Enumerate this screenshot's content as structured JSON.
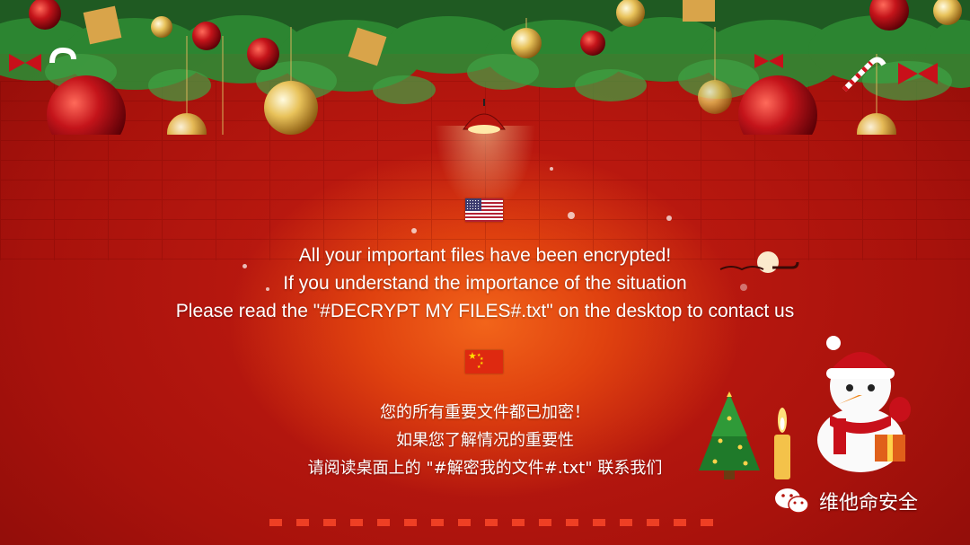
{
  "english": {
    "line1": "All your important files have been encrypted!",
    "line2": "If you understand the importance of the situation",
    "line3": "Please read the \"#DECRYPT MY FILES#.txt\" on the desktop to contact us"
  },
  "chinese": {
    "line1": "您的所有重要文件都已加密！",
    "line2": "如果您了解情况的重要性",
    "line3": "请阅读桌面上的 \"#解密我的文件#.txt\" 联系我们"
  },
  "watermark": {
    "text": "维他命安全",
    "icon": "wechat-icon"
  },
  "decor": {
    "us_flag_icon": "us-flag-icon",
    "cn_flag_icon": "china-flag-icon",
    "colors": {
      "background": "#b5140d",
      "glow": "#f2641a",
      "text": "#ffffff"
    }
  }
}
